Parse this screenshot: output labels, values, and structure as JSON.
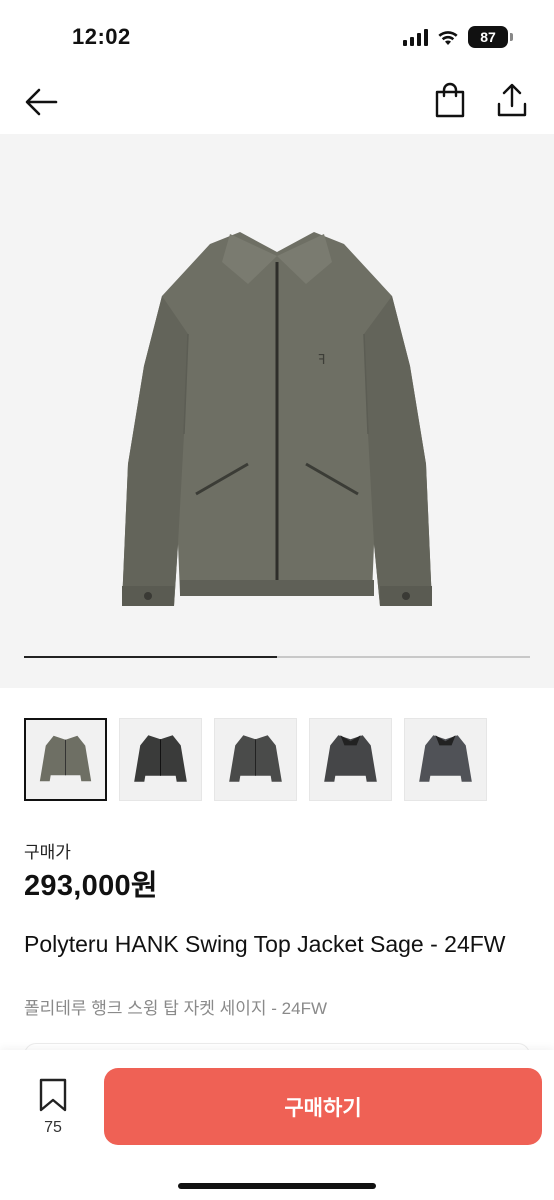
{
  "status_bar": {
    "time": "12:02",
    "battery": "87"
  },
  "nav": {
    "back_icon": "arrow-left-icon",
    "bag_icon": "shopping-bag-icon",
    "share_icon": "share-icon"
  },
  "gallery": {
    "progress": 0.5,
    "thumbnail_count": 5,
    "selected_index": 0
  },
  "product": {
    "price_label": "구매가",
    "price": "293,000원",
    "title_en": "Polyteru HANK Swing Top Jacket Sage - 24FW",
    "title_ko": "폴리테루 행크 스윙 탑 자켓 세이지 - 24FW"
  },
  "bottom": {
    "bookmark_count": "75",
    "buy_label": "구매하기"
  },
  "colors": {
    "accent": "#ef6155",
    "sage": "#6e6e64",
    "charcoal": "#3e3f40"
  }
}
